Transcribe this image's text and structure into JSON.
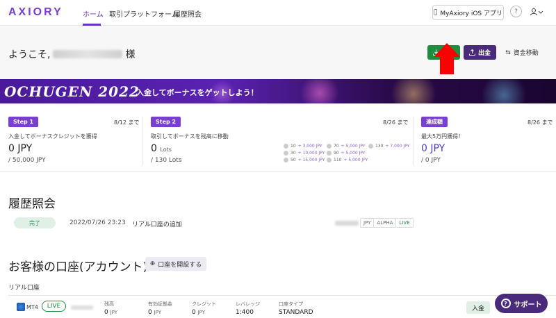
{
  "logo": "AXIORY",
  "nav": {
    "items": [
      {
        "label": "ホーム",
        "active": true
      },
      {
        "label": "取引プラットフォーム",
        "active": false
      },
      {
        "label": "履歴照会",
        "active": false
      }
    ],
    "app_button": "MyAxiory iOS アプリ",
    "help_icon": "question-icon",
    "user_icon": "user-icon"
  },
  "welcome": {
    "prefix": "ようこそ,",
    "suffix": "様"
  },
  "actions": {
    "deposit": "入金",
    "withdraw": "出金",
    "transfer": "資金移動"
  },
  "banner": {
    "title": "OCHUGEN 2022",
    "subtitle": "入金してボーナスをゲットしよう！"
  },
  "steps": [
    {
      "tag": "Step 1",
      "date": "8/12 まで",
      "desc": "入金してボーナスクレジットを獲得",
      "value": "0 JPY",
      "goal": "/ 50,000 JPY"
    },
    {
      "tag": "Step 2",
      "date": "8/26 まで",
      "desc": "取引してボーナスを残高に移動",
      "value": "0",
      "value_unit": "Lots",
      "goal": "/ 130 Lots"
    },
    {
      "tag": "達成額",
      "date": "8/26 まで",
      "desc": "最大5万円獲得！",
      "value": "0 JPY",
      "goal": "/ 0 JPY"
    }
  ],
  "bonus_tiers": [
    {
      "lots": "10",
      "amount": "+ 3,000 JPY"
    },
    {
      "lots": "30",
      "amount": "+ 10,000 JPY"
    },
    {
      "lots": "50",
      "amount": "+ 15,000 JPY"
    },
    {
      "lots": "70",
      "amount": "+ 5,000 JPY"
    },
    {
      "lots": "90",
      "amount": "+ 5,000 JPY"
    },
    {
      "lots": "110",
      "amount": "+ 5,000 JPY"
    },
    {
      "lots": "130",
      "amount": "+ 7,000 JPY"
    }
  ],
  "history": {
    "title": "履歴照会",
    "row": {
      "status": "完了",
      "date": "2022/07/26 23:23",
      "text": "リアル口座の追加",
      "tags": [
        "JPY",
        "ALPHA",
        "LIVE"
      ]
    }
  },
  "accounts": {
    "title": "お客様の口座(アカウント)",
    "open_button": "口座を開設する",
    "real_label": "リアル口座",
    "row": {
      "platform": "MT4",
      "status": "LIVE",
      "cols": [
        {
          "label": "残高",
          "value": "0",
          "unit": "JPY"
        },
        {
          "label": "有効証拠金",
          "value": "0",
          "unit": "JPY"
        },
        {
          "label": "クレジット",
          "value": "0",
          "unit": "JPY"
        },
        {
          "label": "レバレッジ",
          "value": "1:400",
          "unit": ""
        },
        {
          "label": "口座タイプ",
          "value": "STANDARD",
          "unit": ""
        }
      ],
      "deposit": "入金"
    }
  },
  "support": "サポート",
  "colors": {
    "brand": "#7a3fd0",
    "deposit": "#1e8e3e",
    "withdraw": "#4a2a7a",
    "arrow": "#ff0000"
  }
}
